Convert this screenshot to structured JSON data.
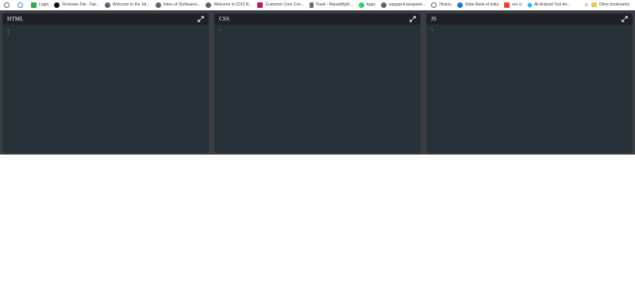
{
  "bookmarks": [
    {
      "label": "",
      "icon": "search-icon",
      "color": "#5f6368"
    },
    {
      "label": "",
      "icon": "google-icon",
      "color": "#4285f4"
    },
    {
      "label": "Login",
      "icon": "chart-icon",
      "color": "#34a853"
    },
    {
      "label": "Firmware File - Dat...",
      "icon": "firmware-icon",
      "color": "#111111"
    },
    {
      "label": "Welcome to the Jid...",
      "icon": "globe-icon",
      "color": "#5f6368"
    },
    {
      "label": "Index of /Softwares...",
      "icon": "globe-icon",
      "color": "#5f6368"
    },
    {
      "label": "Welcome to ICICI B...",
      "icon": "globe-icon",
      "color": "#5f6368"
    },
    {
      "label": "Customer Care Con...",
      "icon": "customer-care-icon",
      "color": "#c2185b"
    },
    {
      "label": "Flash - RepairMyM...",
      "icon": "phone-icon",
      "color": "#6d6d6d"
    },
    {
      "label": "Apps",
      "icon": "whatsapp-icon",
      "color": "#25d366"
    },
    {
      "label": "sapgvprd.lavaparin...",
      "icon": "globe-icon",
      "color": "#5f6368"
    },
    {
      "label": "History",
      "icon": "history-icon",
      "color": "#5f6368"
    },
    {
      "label": "State Bank of India",
      "icon": "sbi-icon",
      "color": "#1a73e8"
    },
    {
      "label": "eer cr",
      "icon": "gmail-icon",
      "color": "#ea4335"
    },
    {
      "label": "All Android Tool An...",
      "icon": "diamond-icon",
      "color": "#29b6f6"
    }
  ],
  "overflow_label": "»",
  "other_bookmarks": "Other bookmarks",
  "panes": [
    {
      "title": "HTML",
      "lines": "1\n2"
    },
    {
      "title": "CSS",
      "lines": "1"
    },
    {
      "title": "JS",
      "lines": "1"
    }
  ],
  "colors": {
    "pane_bg": "#263238",
    "header_bg": "#1e2226",
    "workspace_bg": "#3a3d42"
  }
}
